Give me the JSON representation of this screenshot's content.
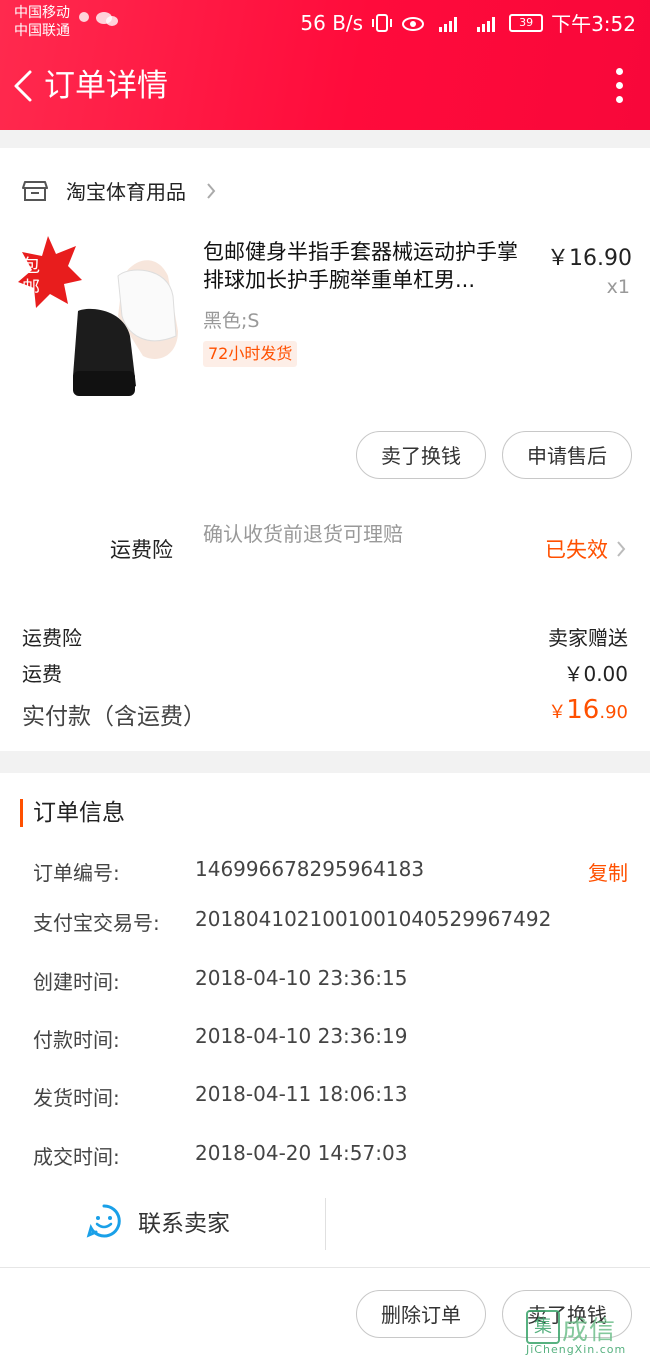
{
  "status_bar": {
    "carrier1": "中国移动",
    "carrier2": "中国联通",
    "speed": "56 B/s",
    "battery": "39",
    "time": "下午3:52"
  },
  "header": {
    "title": "订单详情"
  },
  "shop": {
    "name": "淘宝体育用品"
  },
  "product": {
    "badge": "包邮",
    "title": "包邮健身半指手套器械运动护手掌排球加长护手腕举重单杠男...",
    "price": "￥16.90",
    "qty": "x1",
    "sku": "黑色;S",
    "ship_tag": "72小时发货"
  },
  "actions": {
    "sell": "卖了换钱",
    "after_sale": "申请售后"
  },
  "insurance": {
    "label": "运费险",
    "desc": "确认收货前退货可理赔",
    "status": "已失效"
  },
  "summary": {
    "insurance_label": "运费险",
    "insurance_value": "卖家赠送",
    "shipping_label": "运费",
    "shipping_value": "￥0.00",
    "paid_label": "实付款（含运费）",
    "paid_currency": "￥",
    "paid_int": "16",
    "paid_dec": ".90"
  },
  "order_info": {
    "title": "订单信息",
    "copy": "复制",
    "rows": [
      {
        "label": "订单编号:",
        "value": "146996678295964183"
      },
      {
        "label": "支付宝交易号:",
        "value": "2018041021001001040529967492"
      },
      {
        "label": "创建时间:",
        "value": "2018-04-10 23:36:15"
      },
      {
        "label": "付款时间:",
        "value": "2018-04-10 23:36:19"
      },
      {
        "label": "发货时间:",
        "value": "2018-04-11 18:06:13"
      },
      {
        "label": "成交时间:",
        "value": "2018-04-20 14:57:03"
      }
    ]
  },
  "contact": {
    "label": "联系卖家"
  },
  "bottom": {
    "delete": "删除订单",
    "sell": "卖了换钱"
  },
  "watermark": {
    "mark": "集",
    "text": "成信",
    "url": "JiChengXin.com"
  },
  "colors": {
    "brand": "#ff0b3b",
    "accent": "#ff5000",
    "contact_icon": "#1aa0e8"
  }
}
